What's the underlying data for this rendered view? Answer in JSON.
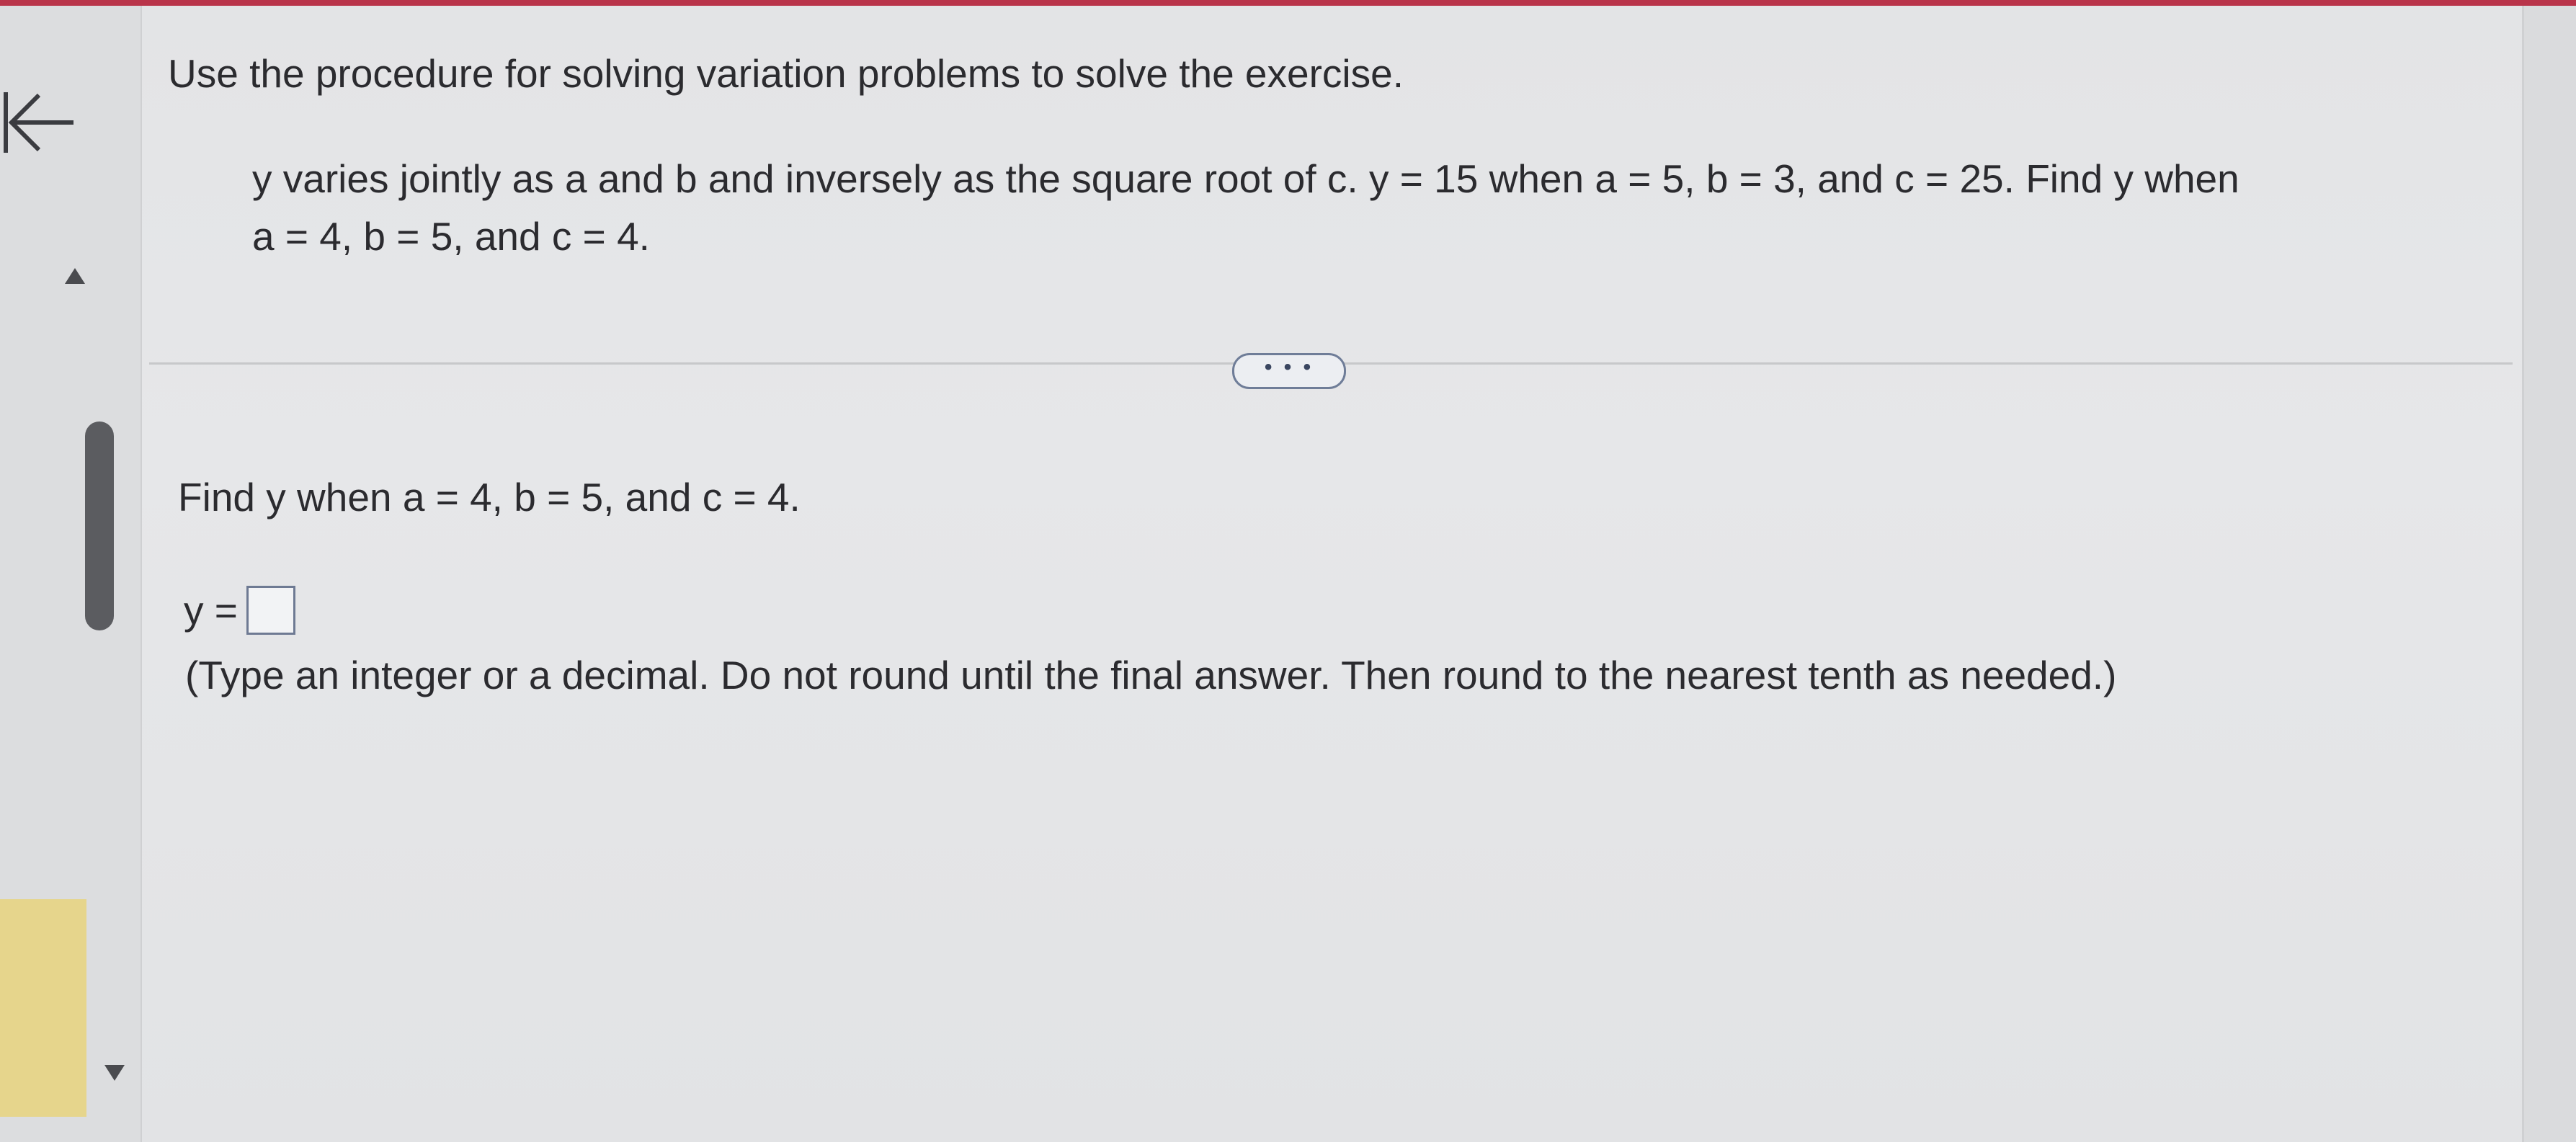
{
  "instruction": "Use the procedure for solving variation problems to solve the exercise.",
  "problem": {
    "line1": "y varies jointly as a and b and inversely as the square root of c. y = 15 when a = 5, b = 3, and c = 25. Find y when",
    "line2": "a = 4, b = 5, and c = 4."
  },
  "more_button": {
    "label": "• • •"
  },
  "question": "Find y when a = 4, b = 5, and c = 4.",
  "answer": {
    "prefix": "y =",
    "value": ""
  },
  "hint": "(Type an integer or a decimal. Do not round until the final answer. Then round to the nearest tenth as needed.)",
  "icons": {
    "back": "back-arrow-icon",
    "scroll_up": "triangle-up-icon",
    "scroll_down": "triangle-down-icon"
  },
  "colors": {
    "top_bar": "#b9344a",
    "answer_border": "#6e7a93",
    "panel_background": "#e6e7e9"
  }
}
